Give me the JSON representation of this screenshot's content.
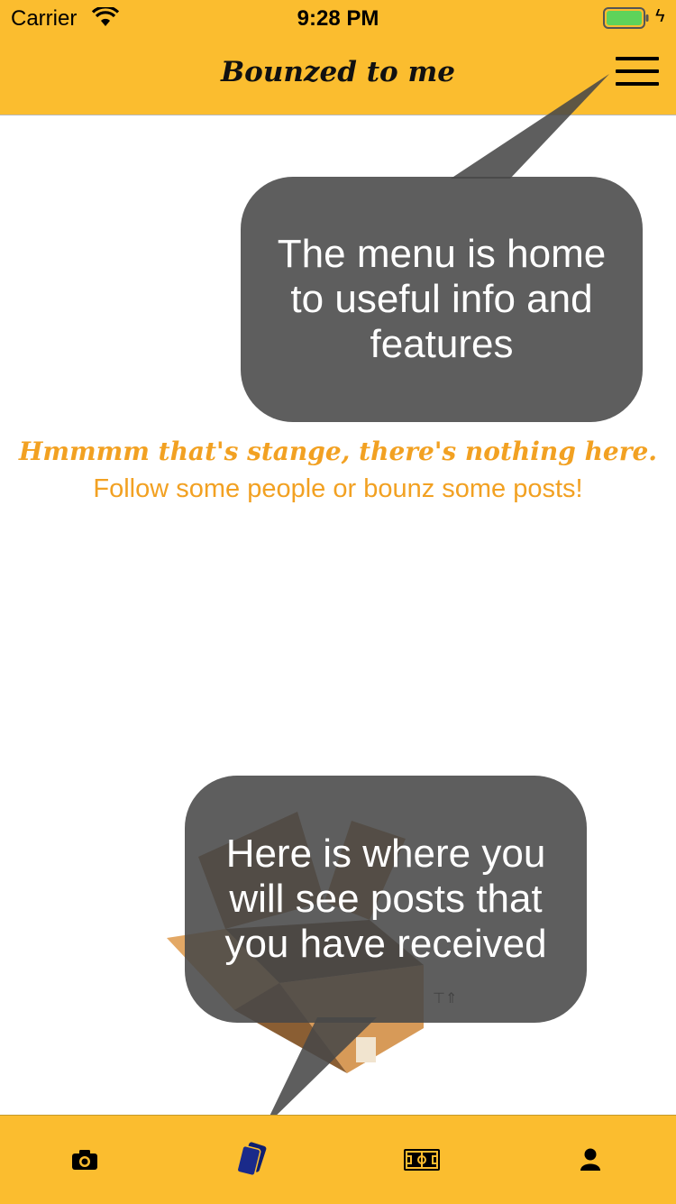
{
  "status_bar": {
    "carrier": "Carrier",
    "time": "9:28 PM"
  },
  "header": {
    "title": "Bounzed to me",
    "menu_icon": "hamburger-menu-icon"
  },
  "empty_state": {
    "line1": "Hmmmm that's stange, there's nothing here.",
    "line2": "Follow some people or bounz some posts!",
    "illustration": "open-cardboard-box"
  },
  "tooltips": {
    "menu": "The menu is home to useful info and features",
    "received": "Here is where you will see posts that you have received"
  },
  "tabs": [
    {
      "icon": "camera-icon",
      "active": false
    },
    {
      "icon": "cards-icon",
      "active": true
    },
    {
      "icon": "field-icon",
      "active": false
    },
    {
      "icon": "profile-icon",
      "active": false
    }
  ],
  "colors": {
    "bar": "#fbbd2f",
    "accent": "#f2a122",
    "active_tab": "#1a2a8a",
    "tooltip": "#484848"
  }
}
